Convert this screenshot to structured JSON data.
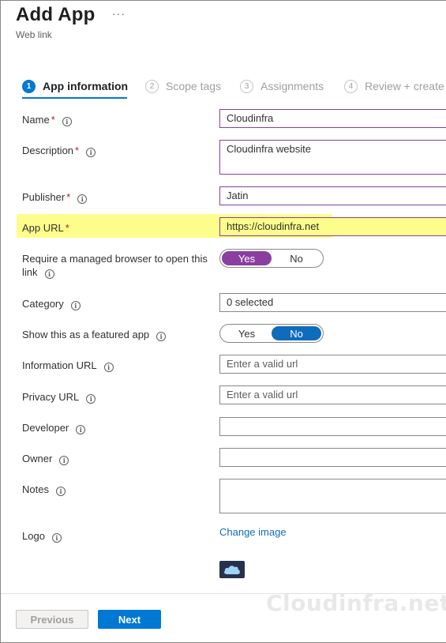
{
  "header": {
    "title": "Add App",
    "more_icon": "ellipsis-icon",
    "more_label": "···",
    "subtitle": "Web link"
  },
  "steps": [
    {
      "num": "1",
      "label": "App information",
      "active": true
    },
    {
      "num": "2",
      "label": "Scope tags",
      "active": false
    },
    {
      "num": "3",
      "label": "Assignments",
      "active": false
    },
    {
      "num": "4",
      "label": "Review + create",
      "active": false
    }
  ],
  "form": {
    "name": {
      "label": "Name",
      "required": "*",
      "value": "Cloudinfra"
    },
    "description": {
      "label": "Description",
      "required": "*",
      "value": "Cloudinfra website"
    },
    "publisher": {
      "label": "Publisher",
      "required": "*",
      "value": "Jatin"
    },
    "app_url": {
      "label": "App URL",
      "required": "*",
      "value": "https://cloudinfra.net"
    },
    "managed_browser": {
      "label": "Require a managed browser to open this link",
      "yes": "Yes",
      "no": "No",
      "selected": "Yes"
    },
    "category": {
      "label": "Category",
      "value": "0 selected"
    },
    "featured": {
      "label": "Show this as a featured app",
      "yes": "Yes",
      "no": "No",
      "selected": "No"
    },
    "information_url": {
      "label": "Information URL",
      "placeholder": "Enter a valid url"
    },
    "privacy_url": {
      "label": "Privacy URL",
      "placeholder": "Enter a valid url"
    },
    "developer": {
      "label": "Developer",
      "value": ""
    },
    "owner": {
      "label": "Owner",
      "value": ""
    },
    "notes": {
      "label": "Notes",
      "value": ""
    },
    "logo": {
      "label": "Logo",
      "change_link": "Change image",
      "thumbnail_icon": "cloud-icon"
    }
  },
  "info_icon": "ⓘ",
  "footer": {
    "previous_label": "Previous",
    "next_label": "Next"
  },
  "watermark": "Cloudinfra.net",
  "colors": {
    "accent_blue": "#0078d4",
    "filled_border_purple": "#8a3fa0",
    "highlight_yellow": "#fdfd8c",
    "required_red": "#a4262c"
  }
}
